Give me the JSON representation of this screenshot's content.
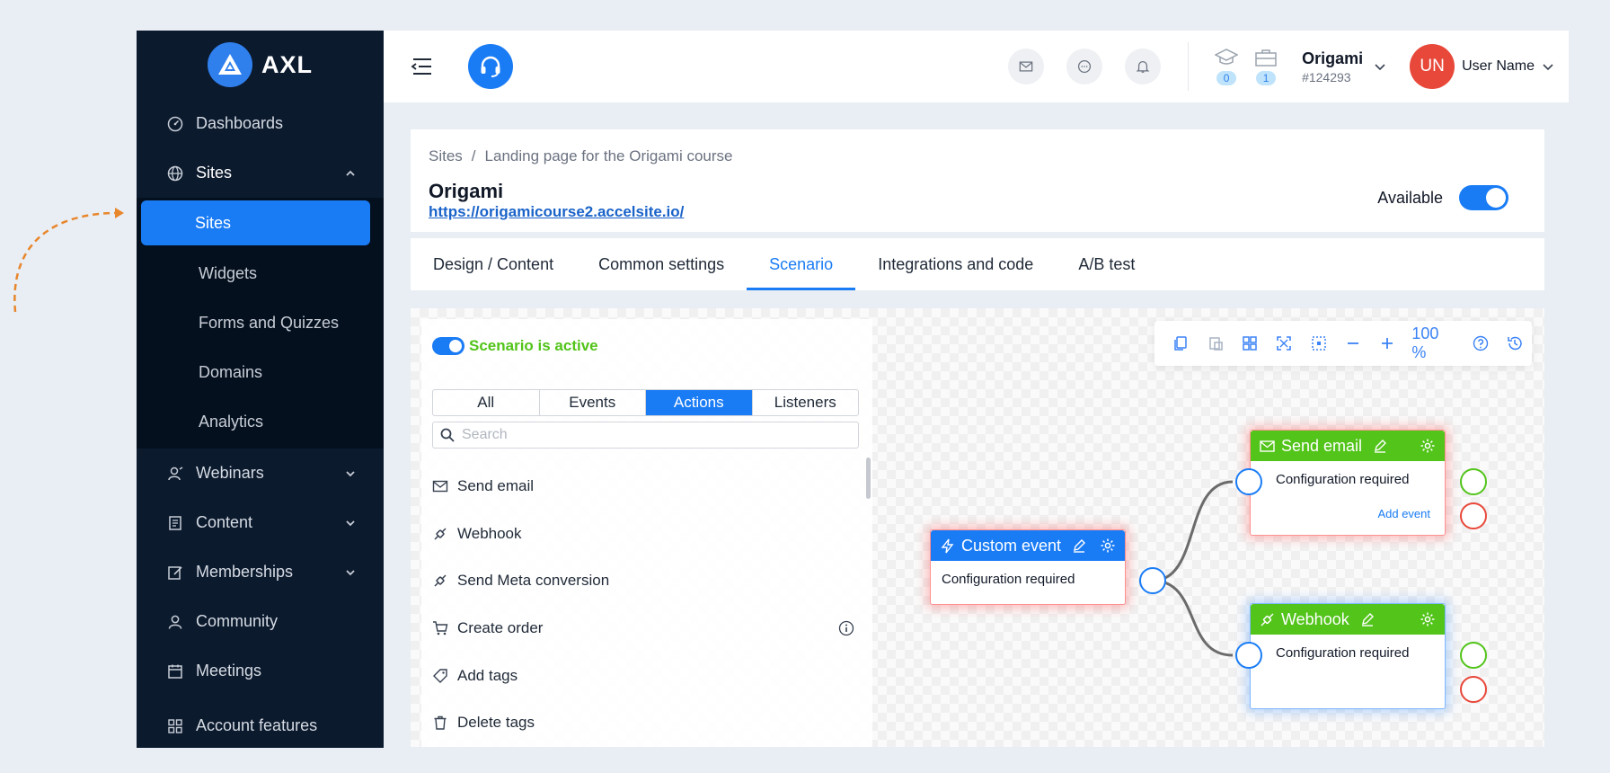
{
  "brand": {
    "name": "AXL"
  },
  "sidebar": {
    "items": [
      {
        "label": "Dashboards",
        "icon": "dashboard-icon"
      },
      {
        "label": "Sites",
        "icon": "globe-icon",
        "expanded": true
      },
      {
        "label": "Webinars",
        "icon": "webinar-icon"
      },
      {
        "label": "Content",
        "icon": "content-icon"
      },
      {
        "label": "Memberships",
        "icon": "edit-icon"
      },
      {
        "label": "Community",
        "icon": "user-icon"
      },
      {
        "label": "Meetings",
        "icon": "calendar-icon"
      },
      {
        "label": "Account features",
        "icon": "grid-icon"
      }
    ],
    "sites_sub": [
      "Sites",
      "Widgets",
      "Forms and Quizzes",
      "Domains",
      "Analytics"
    ],
    "active_sub": "Sites"
  },
  "header": {
    "stats": [
      {
        "icon": "graduation-cap-icon",
        "count": "0"
      },
      {
        "icon": "briefcase-icon",
        "count": "1"
      }
    ],
    "account": {
      "name": "Origami",
      "id": "#124293"
    },
    "user": {
      "initials": "UN",
      "name": "User Name",
      "avatar_color": "#e8483a"
    }
  },
  "site": {
    "breadcrumb": [
      "Sites",
      "Landing page for the Origami course"
    ],
    "breadcrumb_sep": "/",
    "title": "Origami",
    "url": "https://origamicourse2.accelsite.io/",
    "available_label": "Available",
    "available": true
  },
  "tabs": [
    "Design / Content",
    "Common settings",
    "Scenario",
    "Integrations and code",
    "A/B test"
  ],
  "active_tab": "Scenario",
  "scenario": {
    "active_label": "Scenario is active",
    "filters": [
      "All",
      "Events",
      "Actions",
      "Listeners"
    ],
    "active_filter": "Actions",
    "search_placeholder": "Search",
    "actions": [
      {
        "label": "Send email",
        "icon": "mail-icon"
      },
      {
        "label": "Webhook",
        "icon": "webhook-icon"
      },
      {
        "label": "Send Meta conversion",
        "icon": "webhook-icon"
      },
      {
        "label": "Create order",
        "icon": "cart-icon",
        "info": true
      },
      {
        "label": "Add tags",
        "icon": "tag-icon"
      },
      {
        "label": "Delete tags",
        "icon": "trash-icon"
      }
    ],
    "zoom": "100 %",
    "nodes": {
      "custom_event": {
        "title": "Custom event",
        "body": "Configuration required",
        "header_color": "#1a7cf5",
        "glow": "red"
      },
      "send_email": {
        "title": "Send email",
        "body": "Configuration required",
        "link": "Add event",
        "header_color": "#52c41a",
        "glow": "red"
      },
      "webhook": {
        "title": "Webhook",
        "body": "Configuration required",
        "header_color": "#52c41a",
        "glow": "blue"
      }
    }
  },
  "colors": {
    "accent": "#1a7cf5",
    "sidebar_bg": "#0c1a2e",
    "success": "#52c41a",
    "error": "#e8483a"
  }
}
